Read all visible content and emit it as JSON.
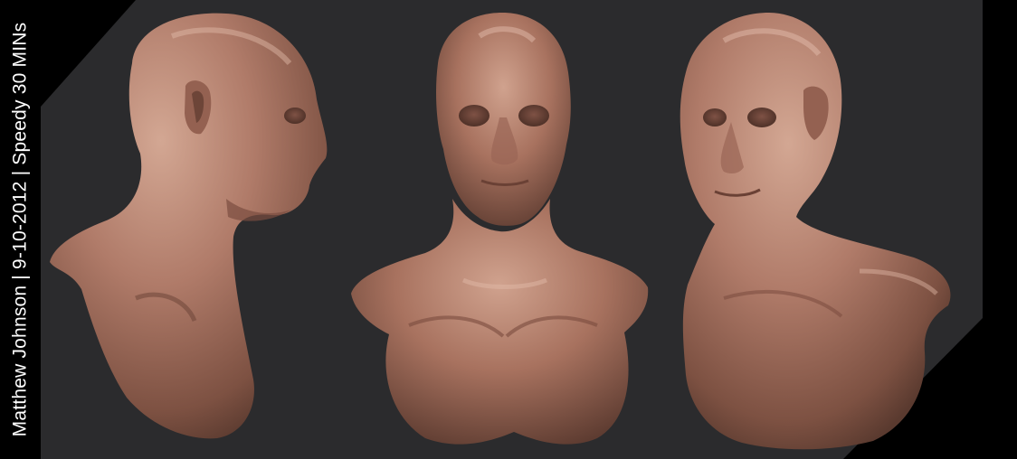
{
  "caption": "Matthew Johnson | 9-10-2012 | Speedy 30 MINs",
  "colors": {
    "background": "#2b2b2d",
    "frame": "#000000",
    "skin_light": "#c89a86",
    "skin_mid": "#a87565",
    "skin_dark": "#6e4538",
    "text": "#ffffff"
  },
  "scene": {
    "subject": "sculpted bald male bust",
    "views": [
      "side-profile-right",
      "front",
      "three-quarter-left"
    ]
  }
}
